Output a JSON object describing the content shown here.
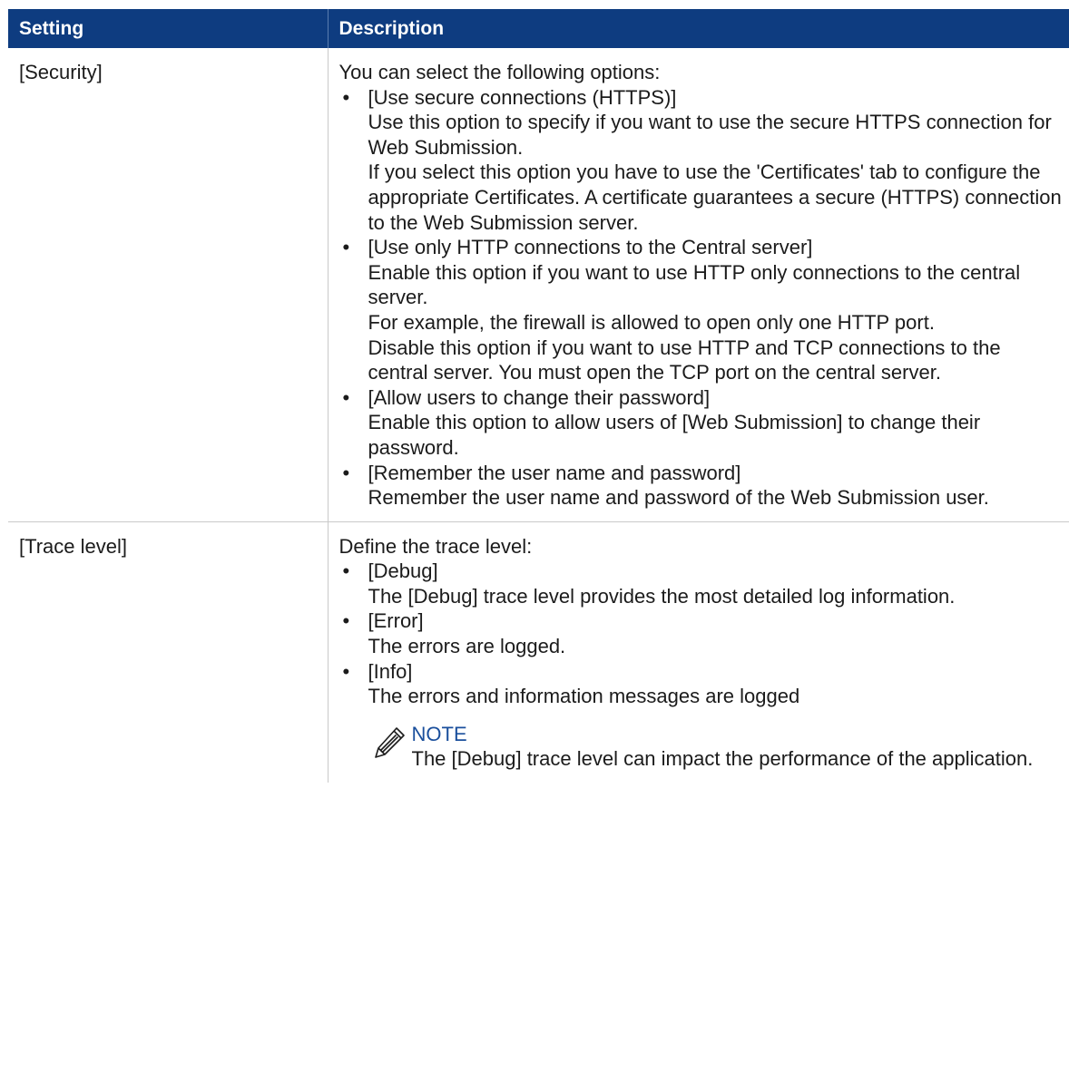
{
  "table": {
    "headers": [
      "Setting",
      "Description"
    ],
    "rows": [
      {
        "setting": "[Security]",
        "intro": "You can select the following options:",
        "options": [
          {
            "title": "[Use secure connections (HTTPS)]",
            "lines": [
              "Use this option to specify if you want to use the secure HTTPS connection for Web Submission.",
              "If you select this option you have to use the 'Certificates' tab to configure the appropriate Certificates. A certificate guarantees a secure (HTTPS) connection to the Web Submission server."
            ]
          },
          {
            "title": "[Use only HTTP connections to the Central server]",
            "lines": [
              "Enable this option if you want to use HTTP only connections to the central server.",
              "For example, the firewall is allowed to open only one HTTP port.",
              "Disable this option if you want to use HTTP and TCP connec­tions to the central server. You must open the TCP port on the central server."
            ]
          },
          {
            "title": "[Allow users to change their password]",
            "lines": [
              "Enable this option to allow users of [Web Submission] to change their password."
            ]
          },
          {
            "title": "[Remember the user name and password]",
            "lines": [
              "Remember the user name and password of the Web Submis­sion user."
            ]
          }
        ]
      },
      {
        "setting": "[Trace level]",
        "intro": "Define the trace level:",
        "options": [
          {
            "title": "[Debug]",
            "lines": [
              "The [Debug] trace level provides the most detailed log informa­tion."
            ]
          },
          {
            "title": "[Error]",
            "lines": [
              "The errors are logged."
            ]
          },
          {
            "title": "[Info]",
            "lines": [
              "The errors and information messages are logged"
            ]
          }
        ],
        "note": {
          "label": "NOTE",
          "text": "The [Debug] trace level can impact the performance of the application.",
          "icon": "pencil-icon"
        }
      }
    ]
  },
  "colors": {
    "header_bg": "#0e3c80",
    "header_text": "#ffffff",
    "note_label": "#1a4f9c",
    "body_text": "#1b1b1b",
    "rule": "#c9c9c9"
  }
}
